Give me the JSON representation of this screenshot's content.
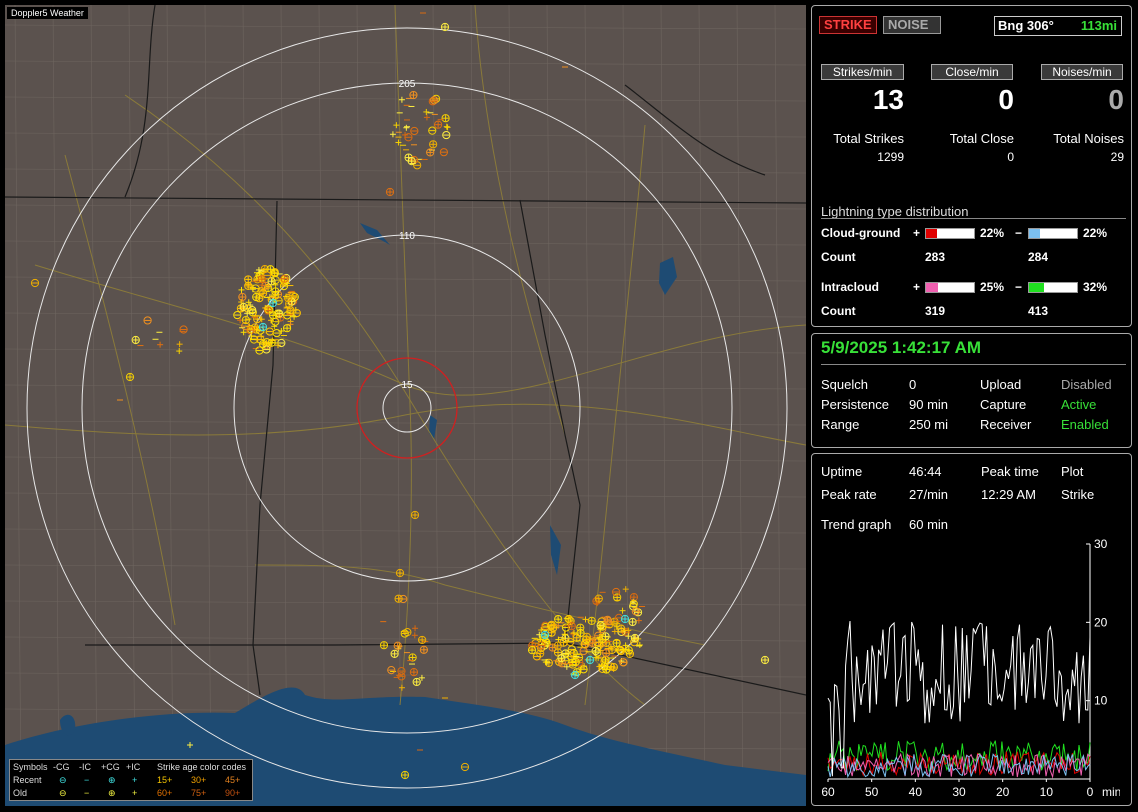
{
  "map": {
    "title": "Doppler5 Weather",
    "ring_labels": [
      "205",
      "110",
      "15"
    ],
    "colors": {
      "land": "#5b524e",
      "water": "#1e4b73",
      "rings": "#e8e8e8",
      "close_ring": "#d02020",
      "roads": "#8a7a3a",
      "borders": "#1a1a1a",
      "counties": "#6e655f"
    }
  },
  "legend": {
    "symbols_label": "Symbols",
    "col_minus_cg": "-CG",
    "col_minus_ic": "-IC",
    "col_plus_cg": "+CG",
    "col_plus_ic": "+IC",
    "age_label": "Strike age color codes",
    "recent_label": "Recent",
    "old_label": "Old",
    "age_codes": [
      "15+",
      "30+",
      "45+",
      "60+",
      "75+",
      "90+"
    ],
    "age_colors": [
      "#f5c400",
      "#f0a000",
      "#e08020",
      "#e07000",
      "#d06010",
      "#c05010"
    ],
    "recent_color": "#40e0e0",
    "old_color": "#f0f040"
  },
  "status": {
    "strike_button": "STRIKE",
    "noise_button": "NOISE",
    "bearing": "Bng 306°",
    "distance": "113mi"
  },
  "rates": {
    "strikes_label": "Strikes/min",
    "close_label": "Close/min",
    "noises_label": "Noises/min",
    "strikes": "13",
    "close": "0",
    "noises": "0",
    "total_strikes_label": "Total Strikes",
    "total_close_label": "Total Close",
    "total_noises_label": "Total Noises",
    "total_strikes": "1299",
    "total_close": "0",
    "total_noises": "29"
  },
  "distribution": {
    "title": "Lightning type distribution",
    "cg_label": "Cloud-ground",
    "ic_label": "Intracloud",
    "count_label": "Count",
    "plus": "+",
    "minus": "−",
    "cg_plus_pct": "22%",
    "cg_minus_pct": "22%",
    "ic_plus_pct": "25%",
    "ic_minus_pct": "32%",
    "cg_plus_count": "283",
    "cg_minus_count": "284",
    "ic_plus_count": "319",
    "ic_minus_count": "413",
    "cg_plus_fill": 0.22,
    "cg_minus_fill": 0.22,
    "ic_plus_fill": 0.25,
    "ic_minus_fill": 0.32,
    "colors": {
      "cg_plus": "#e00000",
      "cg_minus": "#7cc0f0",
      "ic_plus": "#f060b0",
      "ic_minus": "#20e020"
    }
  },
  "settings": {
    "datetime": "5/9/2025 1:42:17 AM",
    "squelch_label": "Squelch",
    "squelch": "0",
    "persistence_label": "Persistence",
    "persistence": "90 min",
    "range_label": "Range",
    "range": "250 mi",
    "upload_label": "Upload",
    "upload": "Disabled",
    "capture_label": "Capture",
    "capture": "Active",
    "receiver_label": "Receiver",
    "receiver": "Enabled"
  },
  "stats": {
    "uptime_label": "Uptime",
    "uptime": "46:44",
    "peak_time_label": "Peak time",
    "peak_time": "12:29 AM",
    "plot_label": "Plot",
    "plot": "Strike",
    "peak_rate_label": "Peak rate",
    "peak_rate": "27/min",
    "trend_label": "Trend graph",
    "trend": "60 min"
  },
  "chart_data": {
    "type": "line",
    "x_ticks": [
      "60",
      "50",
      "40",
      "30",
      "20",
      "10",
      "0"
    ],
    "x_unit": "min",
    "y_ticks": [
      "30",
      "20",
      "10"
    ],
    "ylim": [
      0,
      30
    ],
    "series_colors": [
      "#ffffff",
      "#e00000",
      "#20e020",
      "#7cc0f0",
      "#f060b0"
    ]
  }
}
